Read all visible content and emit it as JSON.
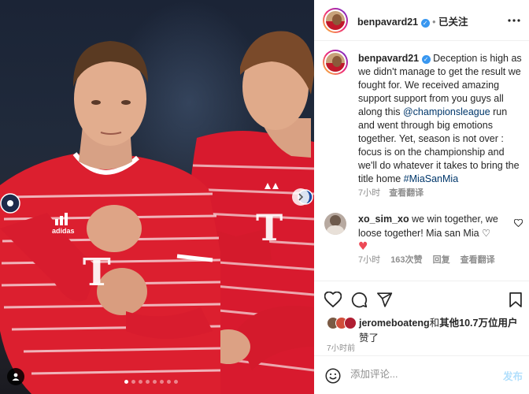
{
  "post": {
    "username": "benpavard21",
    "follow_state": "已关注",
    "caption_text": "Deception is high as we didn't manage to get the result we fought for. We received amazing support support from you guys all along this ",
    "caption_mention": "@championsleague",
    "caption_text_2": " run and went through big emotions together. Yet, season is not over : focus is on the championship and we'll do whatever it takes to bring the title home ",
    "caption_hashtag": "#MiaSanMia",
    "caption_time": "7小时",
    "view_translation": "查看翻译"
  },
  "comments": [
    {
      "username": "xo_sim_xo",
      "text": " we win together, we loose together! Mia san Mia ",
      "heart_emoji": "♡",
      "red_heart": "♥",
      "time": "7小时",
      "likes": "163次赞",
      "reply": "回复",
      "view_translation": "查看翻译"
    }
  ],
  "likes": {
    "username": "jeromeboateng",
    "text_middle": "和",
    "others": "其他10.7万位用户",
    "suffix": "赞了"
  },
  "time_ago": "7小时前",
  "comment_box": {
    "placeholder": "添加评论...",
    "post_label": "发布"
  },
  "jersey_sponsor": "T",
  "icons": {
    "more": "more-horizontal-icon",
    "like": "heart-icon",
    "comment": "comment-bubble-icon",
    "share": "paper-plane-icon",
    "save": "bookmark-icon",
    "emoji": "emoji-smile-icon",
    "next": "chevron-right-icon",
    "tag": "user-tag-icon"
  },
  "colors": {
    "accent": "#0095f6",
    "verified": "#3897f0",
    "like_red": "#ed4956",
    "bayern_red": "#dc052d"
  }
}
